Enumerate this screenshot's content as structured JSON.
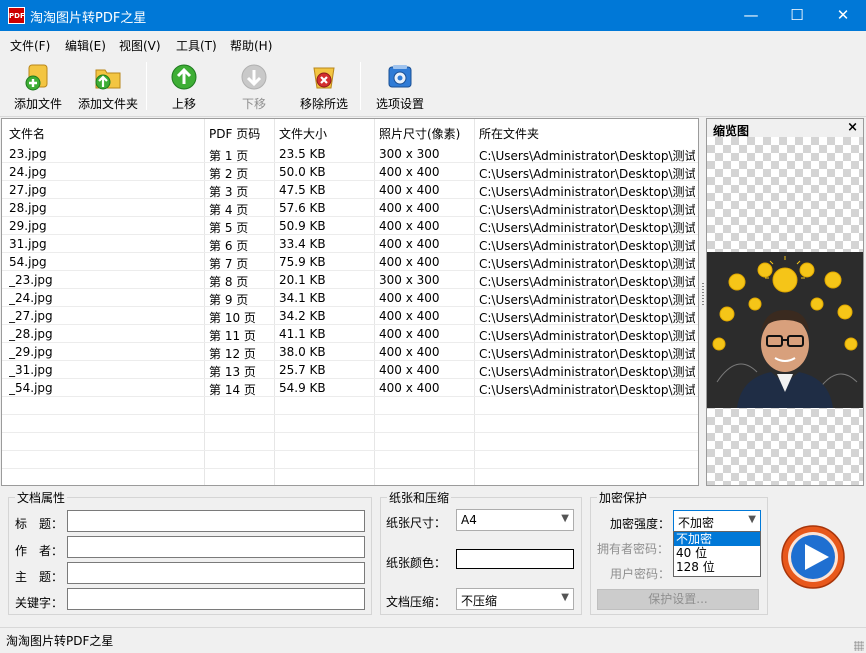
{
  "window": {
    "logo_text": "PDF",
    "title": "淘淘图片转PDF之星",
    "minimize": "—",
    "maximize": "☐",
    "close": "✕"
  },
  "menu": [
    "文件(F)",
    "编辑(E)",
    "视图(V)",
    "工具(T)",
    "帮助(H)"
  ],
  "toolbar": {
    "add_file": "添加文件",
    "add_folder": "添加文件夹",
    "move_up": "上移",
    "move_down": "下移",
    "remove_selected": "移除所选",
    "options": "选项设置"
  },
  "table": {
    "headers": [
      "文件名",
      "PDF 页码",
      "文件大小",
      "照片尺寸(像素)",
      "所在文件夹"
    ],
    "rows": [
      [
        "23.jpg",
        "第 1 页",
        "23.5 KB",
        "300 x 300",
        "C:\\Users\\Administrator\\Desktop\\测试..."
      ],
      [
        "24.jpg",
        "第 2 页",
        "50.0 KB",
        "400 x 400",
        "C:\\Users\\Administrator\\Desktop\\测试..."
      ],
      [
        "27.jpg",
        "第 3 页",
        "47.5 KB",
        "400 x 400",
        "C:\\Users\\Administrator\\Desktop\\测试..."
      ],
      [
        "28.jpg",
        "第 4 页",
        "57.6 KB",
        "400 x 400",
        "C:\\Users\\Administrator\\Desktop\\测试..."
      ],
      [
        "29.jpg",
        "第 5 页",
        "50.9 KB",
        "400 x 400",
        "C:\\Users\\Administrator\\Desktop\\测试..."
      ],
      [
        "31.jpg",
        "第 6 页",
        "33.4 KB",
        "400 x 400",
        "C:\\Users\\Administrator\\Desktop\\测试..."
      ],
      [
        "54.jpg",
        "第 7 页",
        "75.9 KB",
        "400 x 400",
        "C:\\Users\\Administrator\\Desktop\\测试..."
      ],
      [
        "_23.jpg",
        "第 8 页",
        "20.1 KB",
        "300 x 300",
        "C:\\Users\\Administrator\\Desktop\\测试..."
      ],
      [
        "_24.jpg",
        "第 9 页",
        "34.1 KB",
        "400 x 400",
        "C:\\Users\\Administrator\\Desktop\\测试..."
      ],
      [
        "_27.jpg",
        "第 10 页",
        "34.2 KB",
        "400 x 400",
        "C:\\Users\\Administrator\\Desktop\\测试..."
      ],
      [
        "_28.jpg",
        "第 11 页",
        "41.1 KB",
        "400 x 400",
        "C:\\Users\\Administrator\\Desktop\\测试..."
      ],
      [
        "_29.jpg",
        "第 12 页",
        "38.0 KB",
        "400 x 400",
        "C:\\Users\\Administrator\\Desktop\\测试..."
      ],
      [
        "_31.jpg",
        "第 13 页",
        "25.7 KB",
        "400 x 400",
        "C:\\Users\\Administrator\\Desktop\\测试..."
      ],
      [
        "_54.jpg",
        "第 14 页",
        "54.9 KB",
        "400 x 400",
        "C:\\Users\\Administrator\\Desktop\\测试..."
      ]
    ]
  },
  "preview": {
    "title": "缩览图",
    "close": "×"
  },
  "doc_props": {
    "title": "文档属性",
    "fields": [
      {
        "label": "标　题：",
        "value": ""
      },
      {
        "label": "作　者：",
        "value": ""
      },
      {
        "label": "主　题：",
        "value": ""
      },
      {
        "label": "关键字：",
        "value": ""
      }
    ]
  },
  "paper": {
    "title": "纸张和压缩",
    "size_label": "纸张尺寸：",
    "size_value": "A4",
    "color_label": "纸张颜色：",
    "compress_label": "文档压缩：",
    "compress_value": "不压缩"
  },
  "encryption": {
    "title": "加密保护",
    "strength_label": "加密强度：",
    "strength_value": "不加密",
    "options": [
      "不加密",
      "40 位",
      "128 位"
    ],
    "owner_pw_label": "拥有者密码：",
    "user_pw_label": "用户密码：",
    "protect_button": "保护设置..."
  },
  "status": {
    "text": "淘淘图片转PDF之星"
  },
  "colors": {
    "titlebar": "#0078d7",
    "selection": "#0078d7",
    "start_button": "#e8581c"
  }
}
